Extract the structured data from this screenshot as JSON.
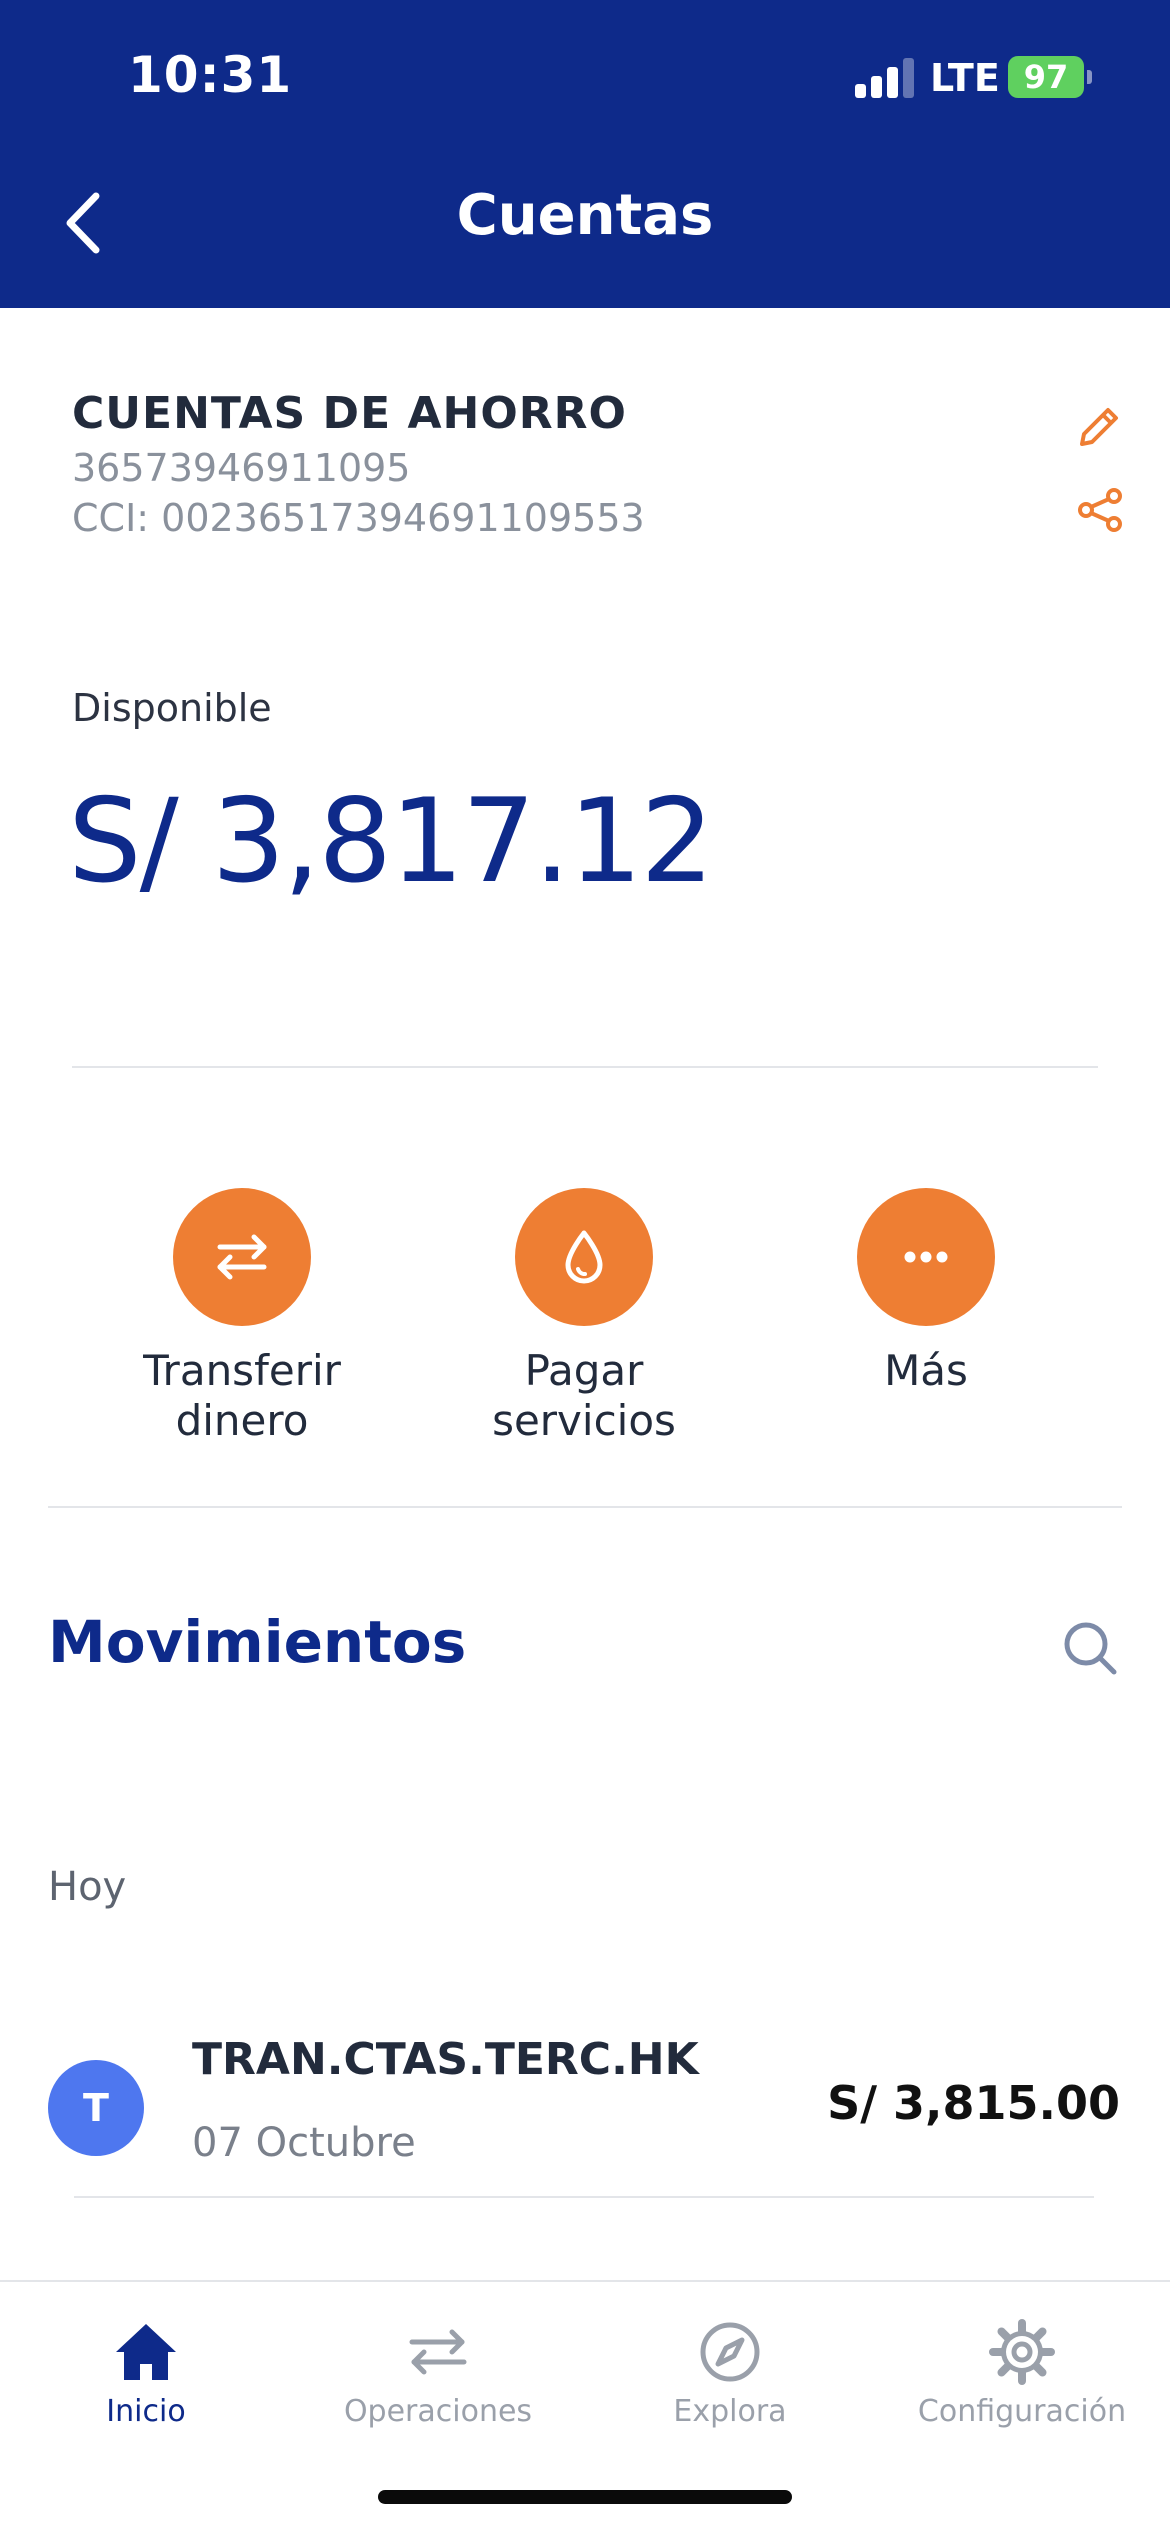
{
  "status_bar": {
    "time": "10:31",
    "network": "LTE",
    "battery": "97"
  },
  "header": {
    "title": "Cuentas"
  },
  "account": {
    "type": "CUENTAS DE AHORRO",
    "number": "36573946911095",
    "cci": "CCI: 00236517394691109553"
  },
  "balance": {
    "label": "Disponible",
    "amount": "S/ 3,817.12"
  },
  "actions": [
    {
      "label": "Transferir\ndinero",
      "icon": "transfer-arrows-icon"
    },
    {
      "label": "Pagar\nservicios",
      "icon": "water-drop-icon"
    },
    {
      "label": "Más",
      "icon": "more-dots-icon"
    }
  ],
  "movements": {
    "title": "Movimientos",
    "group_label": "Hoy",
    "items": [
      {
        "avatar": "T",
        "title": "TRAN.CTAS.TERC.HK",
        "date": "07 Octubre",
        "amount": "S/ 3,815.00"
      }
    ]
  },
  "tabbar": {
    "items": [
      {
        "label": "Inicio",
        "icon": "home-icon",
        "active": true
      },
      {
        "label": "Operaciones",
        "icon": "transfer-arrows-icon",
        "active": false
      },
      {
        "label": "Explora",
        "icon": "compass-icon",
        "active": false
      },
      {
        "label": "Configuración",
        "icon": "gear-icon",
        "active": false
      }
    ]
  },
  "colors": {
    "brand": "#0e2a8a",
    "accent": "#ee7e33",
    "avatar": "#4e77ef",
    "battery": "#5fd05f"
  }
}
